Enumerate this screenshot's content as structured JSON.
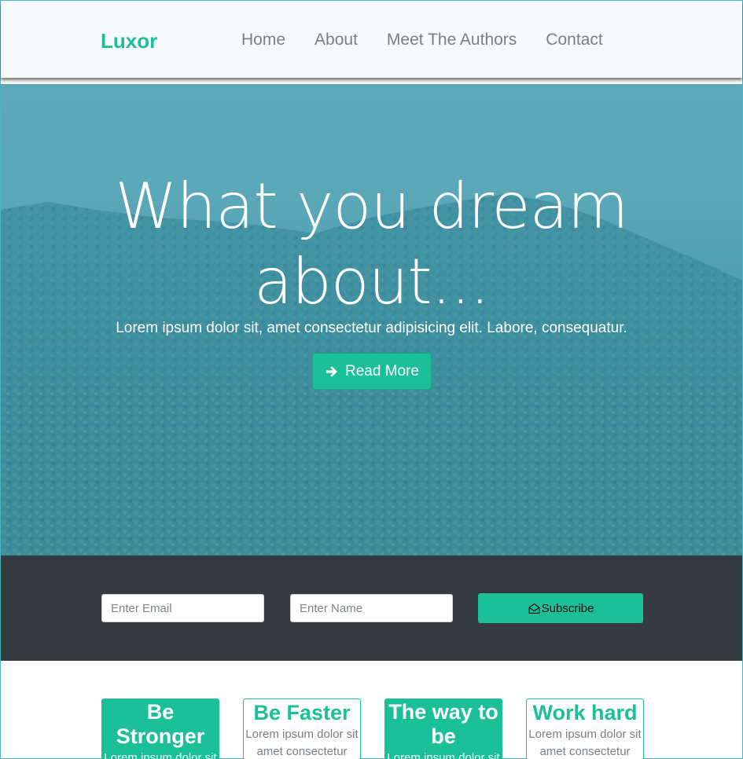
{
  "nav": {
    "brand": "Luxor",
    "links": [
      "Home",
      "About",
      "Meet The Authors",
      "Contact"
    ]
  },
  "hero": {
    "title": "What you dream about...",
    "subtitle": "Lorem ipsum dolor sit, amet consectetur adipisicing elit. Labore, consequatur.",
    "button_label": "Read More",
    "button_icon": "arrow-right-icon"
  },
  "subscribe": {
    "email_placeholder": "Enter Email",
    "name_placeholder": "Enter Name",
    "button_label": "Subscribe",
    "button_icon": "envelope-open-icon"
  },
  "cards": [
    {
      "title": "Be Stronger",
      "text": "Lorem ipsum dolor sit amet consectetur"
    },
    {
      "title": "Be Faster",
      "text": "Lorem ipsum dolor sit amet consectetur"
    },
    {
      "title": "The way to be",
      "text": "Lorem ipsum dolor sit amet consectetur"
    },
    {
      "title": "Work hard",
      "text": "Lorem ipsum dolor sit amet consectetur"
    }
  ],
  "colors": {
    "accent": "#1bbf98",
    "hero_overlay": "#4d9db0",
    "dark_bar": "#343a40",
    "navbar_bg": "#f8f9fa"
  }
}
